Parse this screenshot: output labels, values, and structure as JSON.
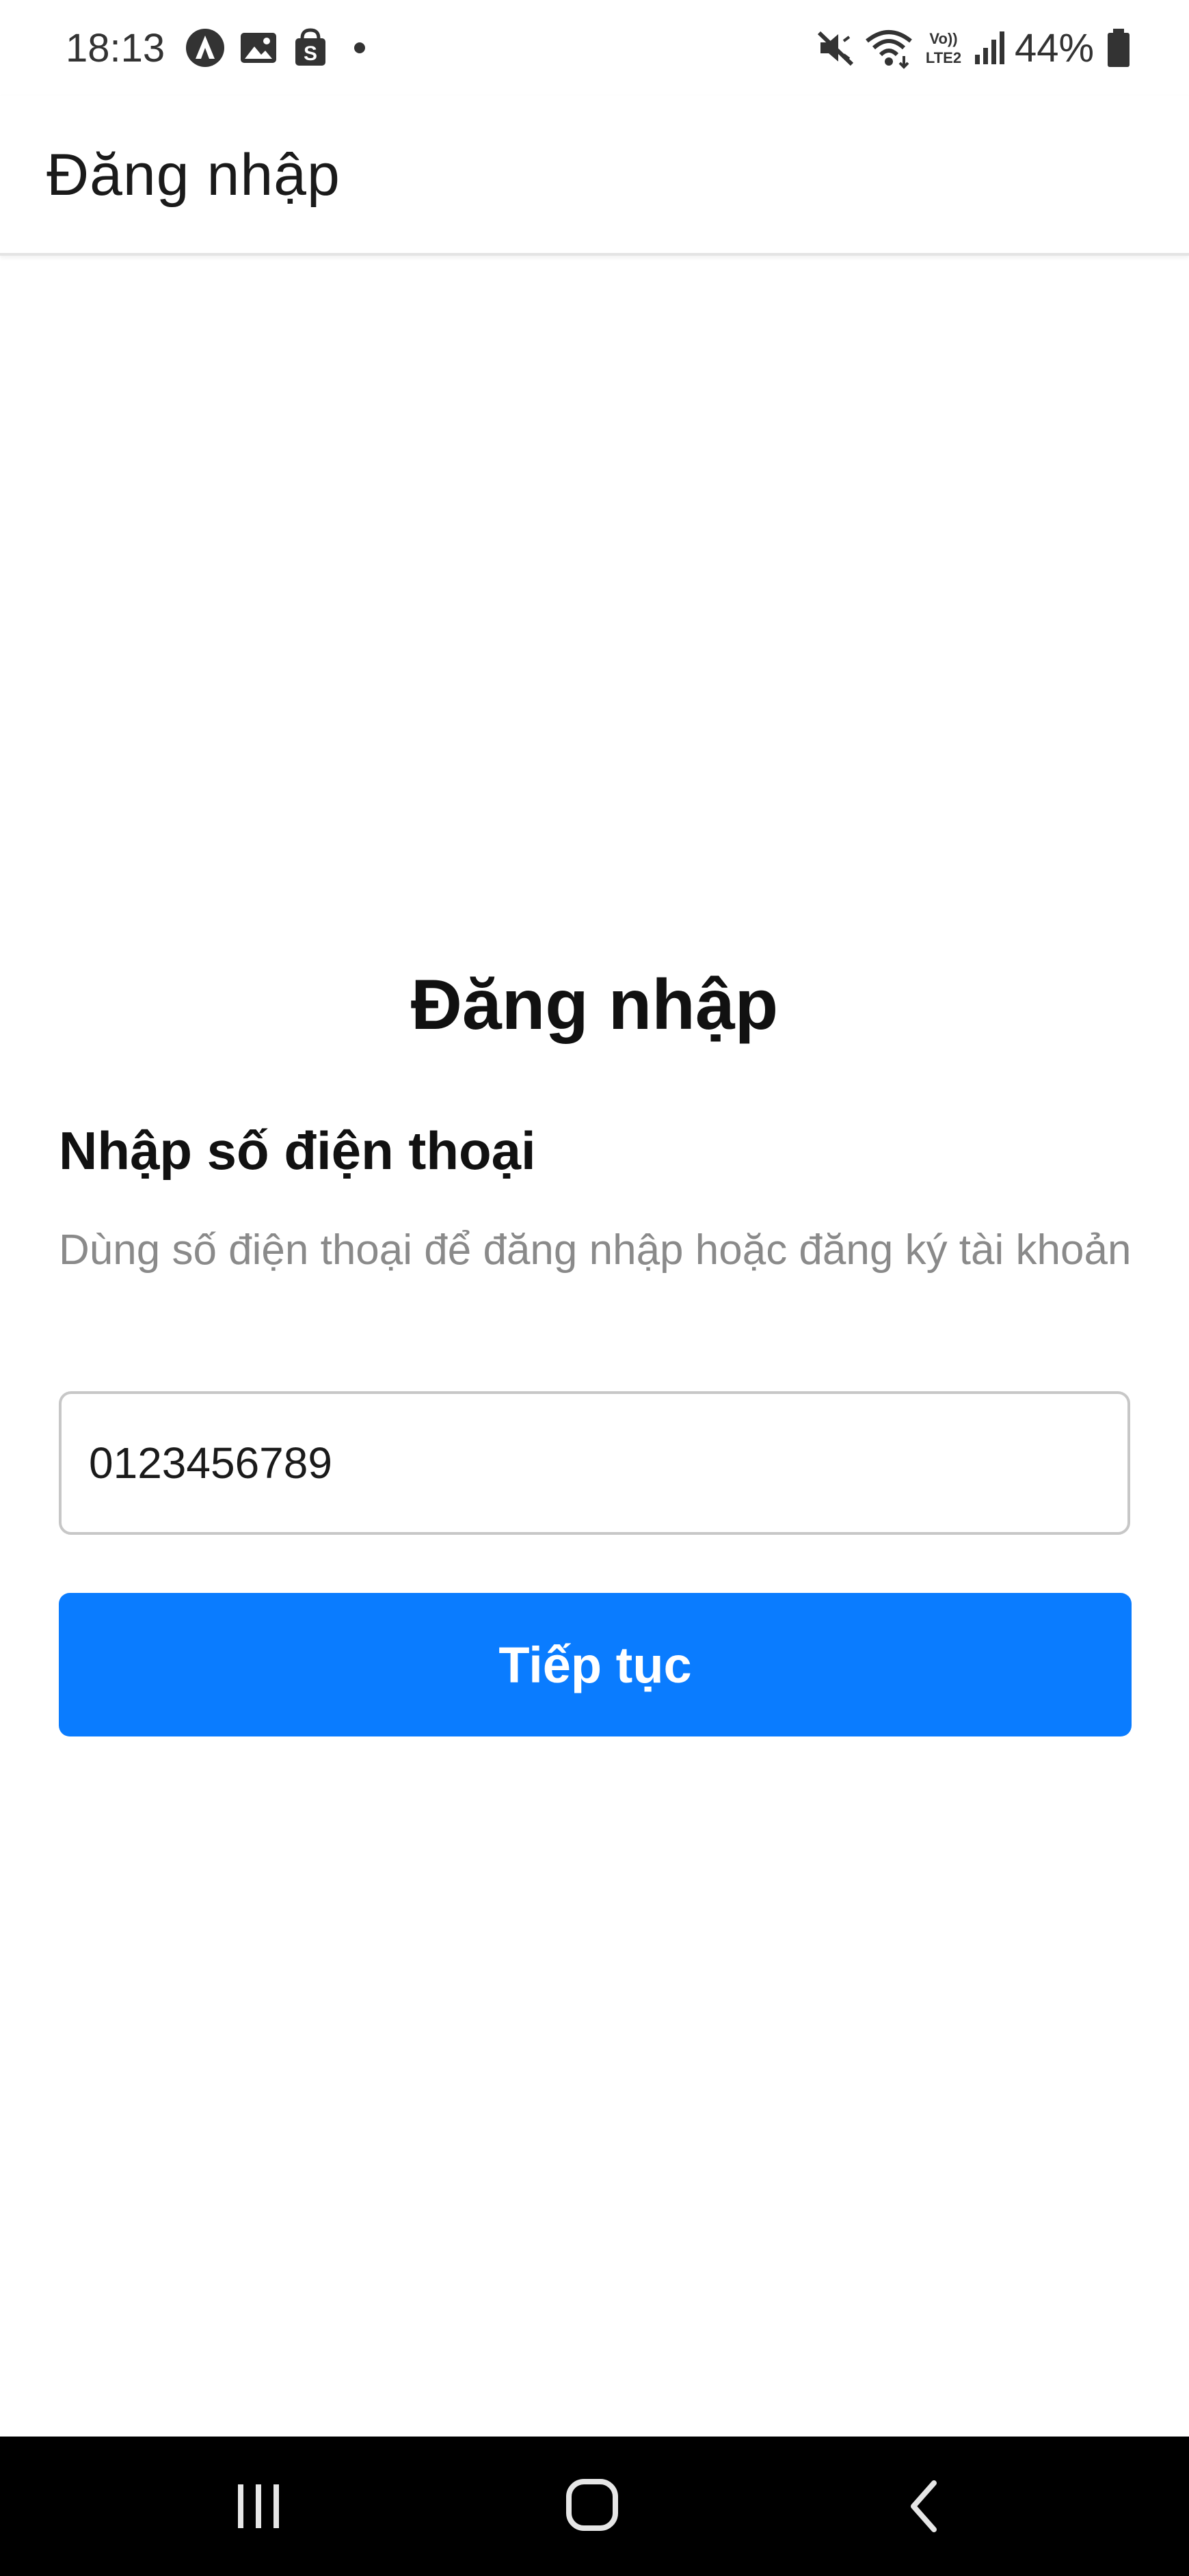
{
  "status_bar": {
    "time": "18:13",
    "battery_percent": "44%",
    "left_icons": [
      "autopilot-icon",
      "image-icon",
      "shopping-bag-icon",
      "notification-dot-icon"
    ],
    "right_icons": [
      "mute-icon",
      "wifi-icon",
      "volte-icon",
      "signal-icon",
      "battery-icon"
    ]
  },
  "app_bar": {
    "title": "Đăng nhập"
  },
  "login": {
    "title": "Đăng nhập",
    "heading": "Nhập số điện thoại",
    "description": "Dùng số điện thoại để đăng nhập hoặc đăng ký tài khoản",
    "phone_value": "0123456789",
    "continue_label": "Tiếp tục"
  },
  "nav_bar": {
    "buttons": [
      "recent-apps-icon",
      "home-icon",
      "back-icon"
    ]
  },
  "colors": {
    "accent": "#0a7cff",
    "text_primary": "#111111",
    "text_secondary": "#8a8a8a",
    "input_border": "#c7c7c7",
    "nav_background": "#000000"
  }
}
